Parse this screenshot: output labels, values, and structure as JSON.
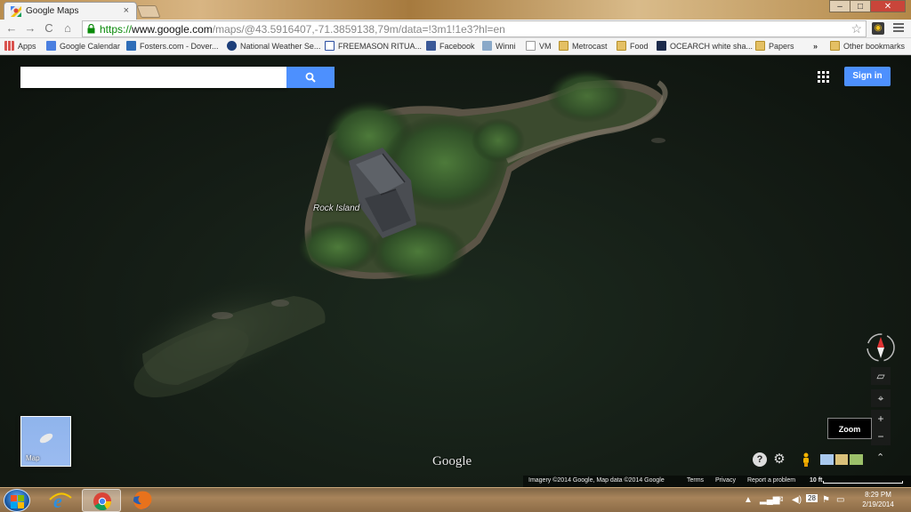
{
  "browser": {
    "tab_title": "Google Maps",
    "tab_close": "×",
    "window_controls": {
      "minimize": "‒",
      "maximize": "□",
      "close": "✕"
    },
    "url": {
      "scheme": "https://",
      "host": "www.google.com",
      "path": "/maps/@43.5916407,-71.3859138,79m/data=!3m1!1e3?hl=en"
    },
    "nav": {
      "back": "←",
      "forward": "→",
      "reload": "C",
      "home": "⌂"
    },
    "star": "☆"
  },
  "bookmarks": [
    {
      "label": "Apps",
      "icon": "apps-icon"
    },
    {
      "label": "Google Calendar",
      "icon": "calendar-icon"
    },
    {
      "label": "Fosters.com - Dover...",
      "icon": "fosters-icon"
    },
    {
      "label": "National Weather Se...",
      "icon": "weather-icon"
    },
    {
      "label": "FREEMASON RITUA...",
      "icon": "compass-square-icon"
    },
    {
      "label": "Facebook",
      "icon": "facebook-icon"
    },
    {
      "label": "Winni",
      "icon": "image-icon"
    },
    {
      "label": "VM",
      "icon": "page-icon"
    },
    {
      "label": "Metrocast",
      "icon": "folder-icon"
    },
    {
      "label": "Food",
      "icon": "folder-icon"
    },
    {
      "label": "OCEARCH white sha...",
      "icon": "ocearch-icon"
    },
    {
      "label": "Papers",
      "icon": "folder-icon"
    }
  ],
  "bookmarks_overflow": "»",
  "other_bookmarks": "Other bookmarks",
  "map": {
    "search_placeholder": "",
    "sign_in": "Sign in",
    "place_label": "Rock Island",
    "minimap_label": "Map",
    "zoom_tooltip": "Zoom",
    "zoom_in": "+",
    "zoom_out": "−",
    "google_logo": "Google",
    "attribution": {
      "imagery": "Imagery ©2014 Google, Map data ©2014 Google",
      "terms": "Terms",
      "privacy": "Privacy",
      "report": "Report a problem",
      "scale": "10 ft"
    },
    "help": "?",
    "settings": "⚙",
    "expand": "⌃"
  },
  "taskbar": {
    "clock_time": "8:29 PM",
    "clock_date": "2/19/2014",
    "calendar_day": "28",
    "tray_arrow": "▲"
  }
}
